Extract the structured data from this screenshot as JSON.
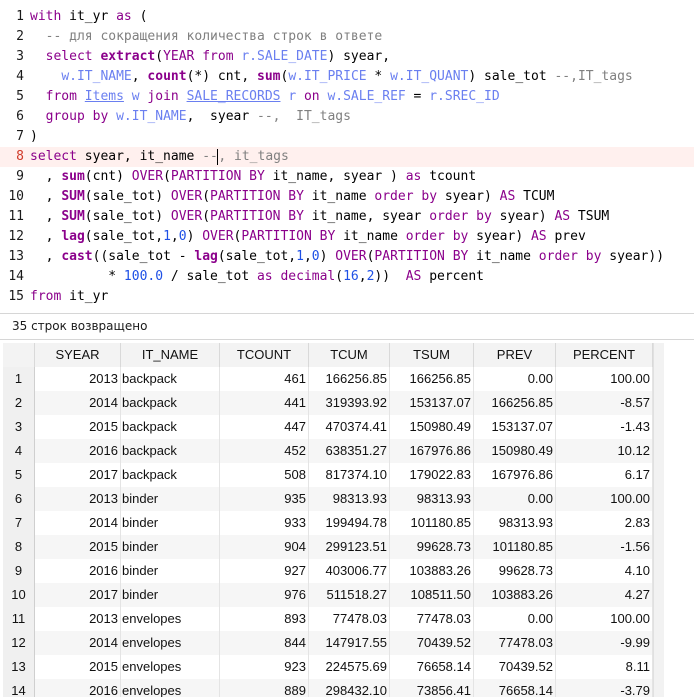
{
  "editor": {
    "lines": [
      {
        "num": "1",
        "tokens": [
          {
            "t": "with",
            "c": "kw"
          },
          {
            "t": " it_yr "
          },
          {
            "t": "as",
            "c": "kw"
          },
          {
            "t": " ("
          }
        ]
      },
      {
        "num": "2",
        "tokens": [
          {
            "t": "  "
          },
          {
            "t": "-- для сокращения количества строк в ответе",
            "c": "cm"
          }
        ]
      },
      {
        "num": "3",
        "tokens": [
          {
            "t": "  "
          },
          {
            "t": "select",
            "c": "kw"
          },
          {
            "t": " "
          },
          {
            "t": "extract",
            "c": "fn"
          },
          {
            "t": "("
          },
          {
            "t": "YEAR",
            "c": "kw"
          },
          {
            "t": " "
          },
          {
            "t": "from",
            "c": "kw"
          },
          {
            "t": " "
          },
          {
            "t": "r.SALE_DATE",
            "c": "al"
          },
          {
            "t": ") syear,"
          }
        ]
      },
      {
        "num": "4",
        "tokens": [
          {
            "t": "    "
          },
          {
            "t": "w.IT_NAME",
            "c": "al"
          },
          {
            "t": ", "
          },
          {
            "t": "count",
            "c": "fn"
          },
          {
            "t": "(*) cnt, "
          },
          {
            "t": "sum",
            "c": "fn"
          },
          {
            "t": "("
          },
          {
            "t": "w.IT_PRICE",
            "c": "al"
          },
          {
            "t": " * "
          },
          {
            "t": "w.IT_QUANT",
            "c": "al"
          },
          {
            "t": ") sale_tot "
          },
          {
            "t": "--,IT_tags",
            "c": "cm"
          }
        ]
      },
      {
        "num": "5",
        "tokens": [
          {
            "t": "  "
          },
          {
            "t": "from",
            "c": "kw"
          },
          {
            "t": " "
          },
          {
            "t": "Items",
            "c": "tb"
          },
          {
            "t": " "
          },
          {
            "t": "w",
            "c": "al"
          },
          {
            "t": " "
          },
          {
            "t": "join",
            "c": "kw"
          },
          {
            "t": " "
          },
          {
            "t": "SALE_RECORDS",
            "c": "tb"
          },
          {
            "t": " "
          },
          {
            "t": "r",
            "c": "al"
          },
          {
            "t": " "
          },
          {
            "t": "on",
            "c": "kw"
          },
          {
            "t": " "
          },
          {
            "t": "w.SALE_REF",
            "c": "al"
          },
          {
            "t": " = "
          },
          {
            "t": "r.SREC_ID",
            "c": "al"
          }
        ]
      },
      {
        "num": "6",
        "tokens": [
          {
            "t": "  "
          },
          {
            "t": "group by",
            "c": "kw"
          },
          {
            "t": " "
          },
          {
            "t": "w.IT_NAME",
            "c": "al"
          },
          {
            "t": ",  syear "
          },
          {
            "t": "--,  IT_tags",
            "c": "cm"
          }
        ]
      },
      {
        "num": "7",
        "tokens": [
          {
            "t": ")"
          }
        ]
      },
      {
        "num": "8",
        "current": true,
        "tokens": [
          {
            "t": "select",
            "c": "kw"
          },
          {
            "t": " syear, it_name "
          },
          {
            "t": "--",
            "c": "cm"
          },
          {
            "caret": true
          },
          {
            "t": ", it_tags",
            "c": "cm"
          }
        ]
      },
      {
        "num": "9",
        "tokens": [
          {
            "t": "  , "
          },
          {
            "t": "sum",
            "c": "fn"
          },
          {
            "t": "(cnt) "
          },
          {
            "t": "OVER",
            "c": "kw"
          },
          {
            "t": "("
          },
          {
            "t": "PARTITION BY",
            "c": "kw"
          },
          {
            "t": " it_name, syear ) "
          },
          {
            "t": "as",
            "c": "kw"
          },
          {
            "t": " tcount"
          }
        ]
      },
      {
        "num": "10",
        "tokens": [
          {
            "t": "  , "
          },
          {
            "t": "SUM",
            "c": "fn"
          },
          {
            "t": "(sale_tot) "
          },
          {
            "t": "OVER",
            "c": "kw"
          },
          {
            "t": "("
          },
          {
            "t": "PARTITION BY",
            "c": "kw"
          },
          {
            "t": " it_name "
          },
          {
            "t": "order by",
            "c": "kw"
          },
          {
            "t": " syear) "
          },
          {
            "t": "AS",
            "c": "kw"
          },
          {
            "t": " TCUM"
          }
        ]
      },
      {
        "num": "11",
        "tokens": [
          {
            "t": "  , "
          },
          {
            "t": "SUM",
            "c": "fn"
          },
          {
            "t": "(sale_tot) "
          },
          {
            "t": "OVER",
            "c": "kw"
          },
          {
            "t": "("
          },
          {
            "t": "PARTITION BY",
            "c": "kw"
          },
          {
            "t": " it_name, syear "
          },
          {
            "t": "order by",
            "c": "kw"
          },
          {
            "t": " syear) "
          },
          {
            "t": "AS",
            "c": "kw"
          },
          {
            "t": " TSUM"
          }
        ]
      },
      {
        "num": "12",
        "tokens": [
          {
            "t": "  , "
          },
          {
            "t": "lag",
            "c": "fn"
          },
          {
            "t": "(sale_tot,"
          },
          {
            "t": "1",
            "c": "nm"
          },
          {
            "t": ","
          },
          {
            "t": "0",
            "c": "nm"
          },
          {
            "t": ") "
          },
          {
            "t": "OVER",
            "c": "kw"
          },
          {
            "t": "("
          },
          {
            "t": "PARTITION BY",
            "c": "kw"
          },
          {
            "t": " it_name "
          },
          {
            "t": "order by",
            "c": "kw"
          },
          {
            "t": " syear) "
          },
          {
            "t": "AS",
            "c": "kw"
          },
          {
            "t": " prev"
          }
        ]
      },
      {
        "num": "13",
        "tokens": [
          {
            "t": "  , "
          },
          {
            "t": "cast",
            "c": "fn"
          },
          {
            "t": "((sale_tot - "
          },
          {
            "t": "lag",
            "c": "fn"
          },
          {
            "t": "(sale_tot,"
          },
          {
            "t": "1",
            "c": "nm"
          },
          {
            "t": ","
          },
          {
            "t": "0",
            "c": "nm"
          },
          {
            "t": ") "
          },
          {
            "t": "OVER",
            "c": "kw"
          },
          {
            "t": "("
          },
          {
            "t": "PARTITION BY",
            "c": "kw"
          },
          {
            "t": " it_name "
          },
          {
            "t": "order by",
            "c": "kw"
          },
          {
            "t": " syear))"
          }
        ]
      },
      {
        "num": "14",
        "tokens": [
          {
            "t": "          * "
          },
          {
            "t": "100.0",
            "c": "nm"
          },
          {
            "t": " / sale_tot "
          },
          {
            "t": "as",
            "c": "kw"
          },
          {
            "t": " "
          },
          {
            "t": "decimal",
            "c": "kw"
          },
          {
            "t": "("
          },
          {
            "t": "16",
            "c": "nm"
          },
          {
            "t": ","
          },
          {
            "t": "2",
            "c": "nm"
          },
          {
            "t": "))  "
          },
          {
            "t": "AS",
            "c": "kw"
          },
          {
            "t": " percent"
          }
        ]
      },
      {
        "num": "15",
        "tokens": [
          {
            "t": "from",
            "c": "kw"
          },
          {
            "t": " it_yr"
          }
        ]
      }
    ]
  },
  "status": {
    "text": "35 строк возвращено"
  },
  "grid": {
    "columns": [
      "SYEAR",
      "IT_NAME",
      "TCOUNT",
      "TCUM",
      "TSUM",
      "PREV",
      "PERCENT"
    ],
    "rows": [
      {
        "n": "1",
        "syear": "2013",
        "it_name": "backpack",
        "tcount": "461",
        "tcum": "166256.85",
        "tsum": "166256.85",
        "prev": "0.00",
        "percent": "100.00"
      },
      {
        "n": "2",
        "syear": "2014",
        "it_name": "backpack",
        "tcount": "441",
        "tcum": "319393.92",
        "tsum": "153137.07",
        "prev": "166256.85",
        "percent": "-8.57"
      },
      {
        "n": "3",
        "syear": "2015",
        "it_name": "backpack",
        "tcount": "447",
        "tcum": "470374.41",
        "tsum": "150980.49",
        "prev": "153137.07",
        "percent": "-1.43"
      },
      {
        "n": "4",
        "syear": "2016",
        "it_name": "backpack",
        "tcount": "452",
        "tcum": "638351.27",
        "tsum": "167976.86",
        "prev": "150980.49",
        "percent": "10.12"
      },
      {
        "n": "5",
        "syear": "2017",
        "it_name": "backpack",
        "tcount": "508",
        "tcum": "817374.10",
        "tsum": "179022.83",
        "prev": "167976.86",
        "percent": "6.17"
      },
      {
        "n": "6",
        "syear": "2013",
        "it_name": "binder",
        "tcount": "935",
        "tcum": "98313.93",
        "tsum": "98313.93",
        "prev": "0.00",
        "percent": "100.00"
      },
      {
        "n": "7",
        "syear": "2014",
        "it_name": "binder",
        "tcount": "933",
        "tcum": "199494.78",
        "tsum": "101180.85",
        "prev": "98313.93",
        "percent": "2.83"
      },
      {
        "n": "8",
        "syear": "2015",
        "it_name": "binder",
        "tcount": "904",
        "tcum": "299123.51",
        "tsum": "99628.73",
        "prev": "101180.85",
        "percent": "-1.56"
      },
      {
        "n": "9",
        "syear": "2016",
        "it_name": "binder",
        "tcount": "927",
        "tcum": "403006.77",
        "tsum": "103883.26",
        "prev": "99628.73",
        "percent": "4.10"
      },
      {
        "n": "10",
        "syear": "2017",
        "it_name": "binder",
        "tcount": "976",
        "tcum": "511518.27",
        "tsum": "108511.50",
        "prev": "103883.26",
        "percent": "4.27"
      },
      {
        "n": "11",
        "syear": "2013",
        "it_name": "envelopes",
        "tcount": "893",
        "tcum": "77478.03",
        "tsum": "77478.03",
        "prev": "0.00",
        "percent": "100.00"
      },
      {
        "n": "12",
        "syear": "2014",
        "it_name": "envelopes",
        "tcount": "844",
        "tcum": "147917.55",
        "tsum": "70439.52",
        "prev": "77478.03",
        "percent": "-9.99"
      },
      {
        "n": "13",
        "syear": "2015",
        "it_name": "envelopes",
        "tcount": "923",
        "tcum": "224575.69",
        "tsum": "76658.14",
        "prev": "70439.52",
        "percent": "8.11"
      },
      {
        "n": "14",
        "syear": "2016",
        "it_name": "envelopes",
        "tcount": "889",
        "tcum": "298432.10",
        "tsum": "73856.41",
        "prev": "76658.14",
        "percent": "-3.79"
      }
    ]
  }
}
